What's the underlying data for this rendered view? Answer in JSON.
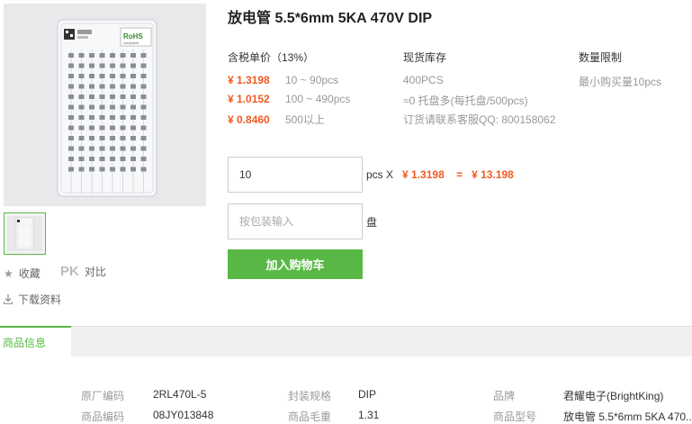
{
  "product": {
    "title": "放电管 5.5*6mm 5KA 470V DIP",
    "image_rohs_text": "RoHS",
    "image_rohs_sub": "compliant"
  },
  "actions": {
    "favorite": "收藏",
    "pk_badge": "PK",
    "compare": "对比",
    "download": "下载资料"
  },
  "pricing": {
    "header": "含税单价（13%）",
    "tiers": [
      {
        "price": "¥ 1.3198",
        "range": "10 ~ 90pcs"
      },
      {
        "price": "¥ 1.0152",
        "range": "100 ~ 490pcs"
      },
      {
        "price": "¥ 0.8460",
        "range": "500以上"
      }
    ]
  },
  "stock": {
    "header": "现货库存",
    "lines": [
      "400PCS",
      "≈0 托盘多(每托盘/500pcs)",
      "订货请联系客服QQ: 800158062"
    ]
  },
  "limit": {
    "header": "数量限制",
    "text": "最小购买量10pcs"
  },
  "order": {
    "qty_value": "10",
    "unit_times": "pcs X",
    "unit_price": "¥ 1.3198",
    "equals": "=",
    "total": "¥ 13.198",
    "pkg_placeholder": "按包装输入",
    "pkg_unit": "盘",
    "add_to_cart": "加入购物车"
  },
  "tabs": {
    "active": "商品信息"
  },
  "specs": [
    {
      "label": "原厂编码",
      "value": "2RL470L-5"
    },
    {
      "label": "封装规格",
      "value": "DIP"
    },
    {
      "label": "品牌",
      "value": "君耀电子(BrightKing)"
    },
    {
      "label": "商品编码",
      "value": "08JY013848"
    },
    {
      "label": "商品毛重",
      "value": "1.31"
    },
    {
      "label": "商品型号",
      "value": "放电管 5.5*6mm 5KA 470..."
    }
  ],
  "colors": {
    "accent_green": "#59b845",
    "price_orange": "#f05a22"
  },
  "icons": [
    "star-icon",
    "download-icon"
  ]
}
